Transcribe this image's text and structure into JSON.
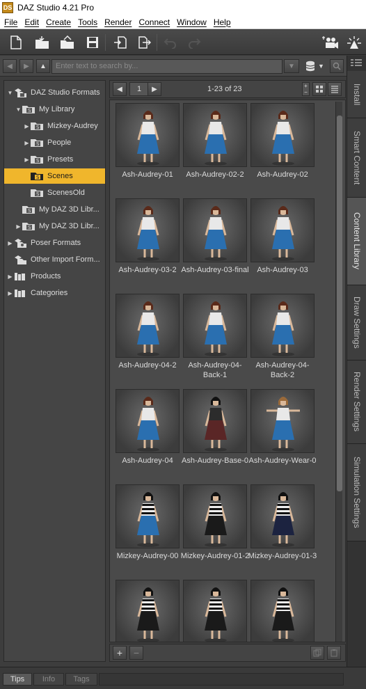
{
  "window": {
    "logo": "DS",
    "title": "DAZ Studio 4.21 Pro"
  },
  "menu": [
    "File",
    "Edit",
    "Create",
    "Tools",
    "Render",
    "Connect",
    "Window",
    "Help"
  ],
  "toolbar": {
    "icons": [
      "new-file-icon",
      "open-folder-icon",
      "open-recent-icon",
      "save-icon",
      "merge-icon",
      "export-icon",
      "undo-icon",
      "redo-icon",
      "create-camera-icon",
      "light-icon"
    ]
  },
  "search": {
    "placeholder": "Enter text to search by..."
  },
  "tree": {
    "items": [
      {
        "label": "DAZ Studio Formats",
        "depth": 0,
        "expanded": true,
        "icon": "library-icon"
      },
      {
        "label": "My Library",
        "depth": 1,
        "expanded": true,
        "icon": "folder-icon"
      },
      {
        "label": "Mizkey-Audrey",
        "depth": 2,
        "expanded": false,
        "icon": "folder-icon"
      },
      {
        "label": "People",
        "depth": 2,
        "expanded": false,
        "icon": "folder-icon"
      },
      {
        "label": "Presets",
        "depth": 2,
        "expanded": false,
        "icon": "folder-icon"
      },
      {
        "label": "Scenes",
        "depth": 2,
        "expanded": null,
        "icon": "folder-icon",
        "selected": true
      },
      {
        "label": "ScenesOld",
        "depth": 2,
        "expanded": null,
        "icon": "folder-icon"
      },
      {
        "label": "My DAZ 3D Libr...",
        "depth": 1,
        "expanded": null,
        "icon": "folder-icon"
      },
      {
        "label": "My DAZ 3D Libr...",
        "depth": 1,
        "expanded": false,
        "icon": "folder-icon"
      },
      {
        "label": "Poser Formats",
        "depth": 0,
        "expanded": false,
        "icon": "poser-icon"
      },
      {
        "label": "Other Import Form...",
        "depth": 0,
        "expanded": null,
        "icon": "import-icon"
      },
      {
        "label": "Products",
        "depth": 0,
        "expanded": false,
        "icon": "products-icon"
      },
      {
        "label": "Categories",
        "depth": 0,
        "expanded": false,
        "icon": "categories-icon"
      }
    ]
  },
  "pager": {
    "page": "1",
    "range": "1-23 of 23"
  },
  "tiles": [
    {
      "label": "Ash-Audrey-01",
      "outfit": "blue"
    },
    {
      "label": "Ash-Audrey-02-2",
      "outfit": "blue"
    },
    {
      "label": "Ash-Audrey-02",
      "outfit": "blue"
    },
    {
      "label": "Ash-Audrey-03-2",
      "outfit": "blue"
    },
    {
      "label": "Ash-Audrey-03-final",
      "outfit": "blue"
    },
    {
      "label": "Ash-Audrey-03",
      "outfit": "blue"
    },
    {
      "label": "Ash-Audrey-04-2",
      "outfit": "blue"
    },
    {
      "label": "Ash-Audrey-04-Back-1",
      "outfit": "blue"
    },
    {
      "label": "Ash-Audrey-04-Back-2",
      "outfit": "blue"
    },
    {
      "label": "Ash-Audrey-04",
      "outfit": "blue"
    },
    {
      "label": "Ash-Audrey-Base-0",
      "outfit": "dark"
    },
    {
      "label": "Ash-Audrey-Wear-0",
      "outfit": "tpose"
    },
    {
      "label": "Mizkey-Audrey-00",
      "outfit": "stripe-blue"
    },
    {
      "label": "Mizkey-Audrey-01-2",
      "outfit": "stripe-black"
    },
    {
      "label": "Mizkey-Audrey-01-3",
      "outfit": "stripe-navy"
    },
    {
      "label": "",
      "outfit": "stripe-black"
    },
    {
      "label": "",
      "outfit": "stripe-black"
    },
    {
      "label": "",
      "outfit": "stripe-black"
    }
  ],
  "side_tabs": [
    {
      "label": "Install",
      "active": false
    },
    {
      "label": "Smart Content",
      "active": false
    },
    {
      "label": "Content Library",
      "active": true
    },
    {
      "label": "Draw Settings",
      "active": false
    },
    {
      "label": "Render Settings",
      "active": false
    },
    {
      "label": "Simulation Settings",
      "active": false
    }
  ],
  "bottom_tabs": [
    {
      "label": "Tips",
      "active": true
    },
    {
      "label": "Info",
      "active": false
    },
    {
      "label": "Tags",
      "active": false
    }
  ],
  "colors": {
    "selection": "#f0b62c",
    "panel": "#3d3d3d"
  }
}
